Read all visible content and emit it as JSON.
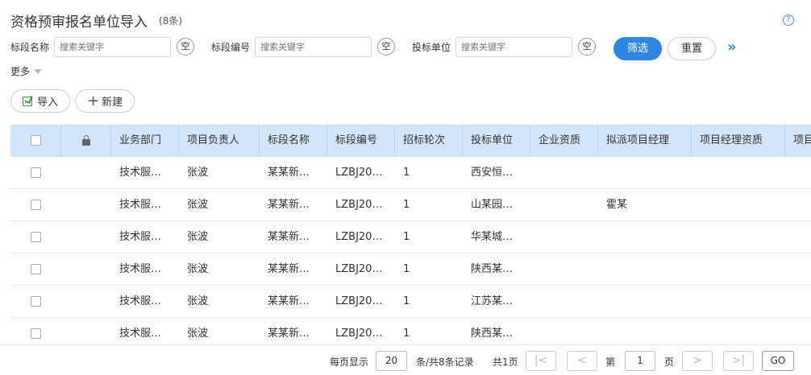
{
  "header": {
    "title": "资格预审报名单位导入",
    "count": "(8条)",
    "help": "?"
  },
  "filters": [
    {
      "label": "标段名称",
      "placeholder": "搜索关键字",
      "clear": "空"
    },
    {
      "label": "标段编号",
      "placeholder": "搜索关键字",
      "clear": "空"
    },
    {
      "label": "投标单位",
      "placeholder": "搜索关键字",
      "clear": "空"
    }
  ],
  "buttons": {
    "filter": "筛选",
    "reset": "重置",
    "expand": "»",
    "more": "更多",
    "import": "导入",
    "new": "新建"
  },
  "table": {
    "columns": [
      "业务部门",
      "项目负责人",
      "标段名称",
      "标段编号",
      "招标轮次",
      "投标单位",
      "企业资质",
      "拟派项目经理",
      "项目经理资质",
      "项目"
    ],
    "rows": [
      [
        "技术服…",
        "张波",
        "某某新…",
        "LZBJ20…",
        "1",
        "西安恒…",
        "",
        "",
        "",
        ""
      ],
      [
        "技术服…",
        "张波",
        "某某新…",
        "LZBJ20…",
        "1",
        "山某园…",
        "",
        "霍某",
        "",
        ""
      ],
      [
        "技术服…",
        "张波",
        "某某新…",
        "LZBJ20…",
        "1",
        "华某城…",
        "",
        "",
        "",
        ""
      ],
      [
        "技术服…",
        "张波",
        "某某新…",
        "LZBJ20…",
        "1",
        "陕西某…",
        "",
        "",
        "",
        ""
      ],
      [
        "技术服…",
        "张波",
        "某某新…",
        "LZBJ20…",
        "1",
        "江苏某…",
        "",
        "",
        "",
        ""
      ],
      [
        "技术服…",
        "张波",
        "某某新…",
        "LZBJ20…",
        "1",
        "陕西某…",
        "",
        "",
        "",
        ""
      ]
    ]
  },
  "pager": {
    "per_page_label": "每页显示",
    "per_page_value": "20",
    "records": "条/共8条记录",
    "total_pages": "共1页",
    "first": "|<",
    "prev": "<",
    "page_prefix": "第",
    "page_value": "1",
    "page_suffix": "页",
    "next": ">",
    "last": ">|",
    "go": "GO"
  }
}
